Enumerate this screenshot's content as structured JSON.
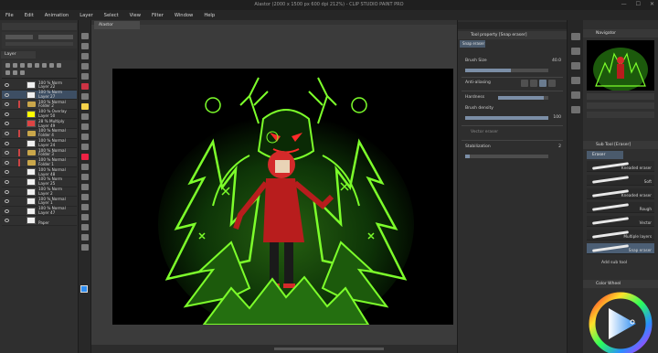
{
  "app": {
    "title": "Alastor (2000 x 1500 px 600 dpi 212%) - CLIP STUDIO PAINT PRO",
    "window_controls": [
      "—",
      "☐",
      "✕"
    ]
  },
  "menu": [
    "File",
    "Edit",
    "Animation",
    "Layer",
    "Select",
    "View",
    "Filter",
    "Window",
    "Help"
  ],
  "layer_panel": {
    "tab_label": "Layer",
    "layers": [
      {
        "mode": "100 % Norm",
        "name": "Layer 22",
        "color": "#f0f0f0",
        "type": "layer",
        "selected": false
      },
      {
        "mode": "100 % Norm",
        "name": "Layer 27",
        "color": "#f0f0f0",
        "type": "layer",
        "selected": true
      },
      {
        "mode": "100 % Normal",
        "name": "Folder 2",
        "color": "#d44",
        "type": "folder",
        "selected": false
      },
      {
        "mode": "100 % Overlay",
        "name": "Layer 50",
        "color": "#ff0",
        "type": "layer",
        "selected": false
      },
      {
        "mode": "28 % Multiply",
        "name": "Layer 49",
        "color": "#d44",
        "type": "layer",
        "selected": false
      },
      {
        "mode": "100 % Normal",
        "name": "Folder 4",
        "color": "#d44",
        "type": "folder",
        "selected": false
      },
      {
        "mode": "100 % Normal",
        "name": "Layer 24",
        "color": "#f0f0f0",
        "type": "layer",
        "selected": false
      },
      {
        "mode": "100 % Normal",
        "name": "Folder 3",
        "color": "#d44",
        "type": "folder",
        "selected": false
      },
      {
        "mode": "100 % Normal",
        "name": "Folder 1",
        "color": "#d44",
        "type": "folder",
        "selected": false
      },
      {
        "mode": "100 % Normal",
        "name": "Layer 48",
        "color": "#f0f0f0",
        "type": "layer",
        "selected": false
      },
      {
        "mode": "100 % Norm",
        "name": "Layer 25",
        "color": "#f0f0f0",
        "type": "layer",
        "selected": false
      },
      {
        "mode": "100 % Norm",
        "name": "Layer 2",
        "color": "#f0f0f0",
        "type": "layer",
        "selected": false
      },
      {
        "mode": "100 % Normal",
        "name": "Layer 1",
        "color": "#f0f0f0",
        "type": "layer",
        "selected": false
      },
      {
        "mode": "100 % Normal",
        "name": "Layer 47",
        "color": "#f0f0f0",
        "type": "layer",
        "selected": false
      },
      {
        "mode": "",
        "name": "Paper",
        "color": "#f0f0f0",
        "type": "paper",
        "selected": false
      }
    ]
  },
  "document_tab": "Alastor",
  "tool_property": {
    "header": "Tool property [Snap eraser]",
    "subtool_label": "Snap eraser",
    "brush_size": {
      "label": "Brush Size",
      "value": "40.0",
      "fill": 0.55
    },
    "anti_aliasing": {
      "label": "Anti-aliasing"
    },
    "hardness": {
      "label": "Hardness",
      "fill": 0.9
    },
    "brush_density": {
      "label": "Brush density",
      "value": "100",
      "fill": 1.0
    },
    "vector_eraser": {
      "label": "Vector eraser"
    },
    "stabilization": {
      "label": "Stabilization",
      "value": "2",
      "fill": 0.05
    }
  },
  "navigator": {
    "header": "Navigator"
  },
  "sub_tool": {
    "header": "Sub Tool [Eraser]",
    "tab": "Eraser",
    "items": [
      "Kneaded eraser",
      "Soft",
      "Kneaded eraser",
      "Rough",
      "Vector",
      "Multiple layers",
      "Snap eraser"
    ],
    "selected_index": 6,
    "add_label": "Add sub tool"
  },
  "color_wheel": {
    "header": "Color Wheel"
  },
  "colors": {
    "accent_select": "#3d4e63",
    "neon_green": "#7dff2b",
    "dark_green": "#0f3a08",
    "red": "#d42a2a",
    "primary_swatch": "#2f8df0"
  }
}
